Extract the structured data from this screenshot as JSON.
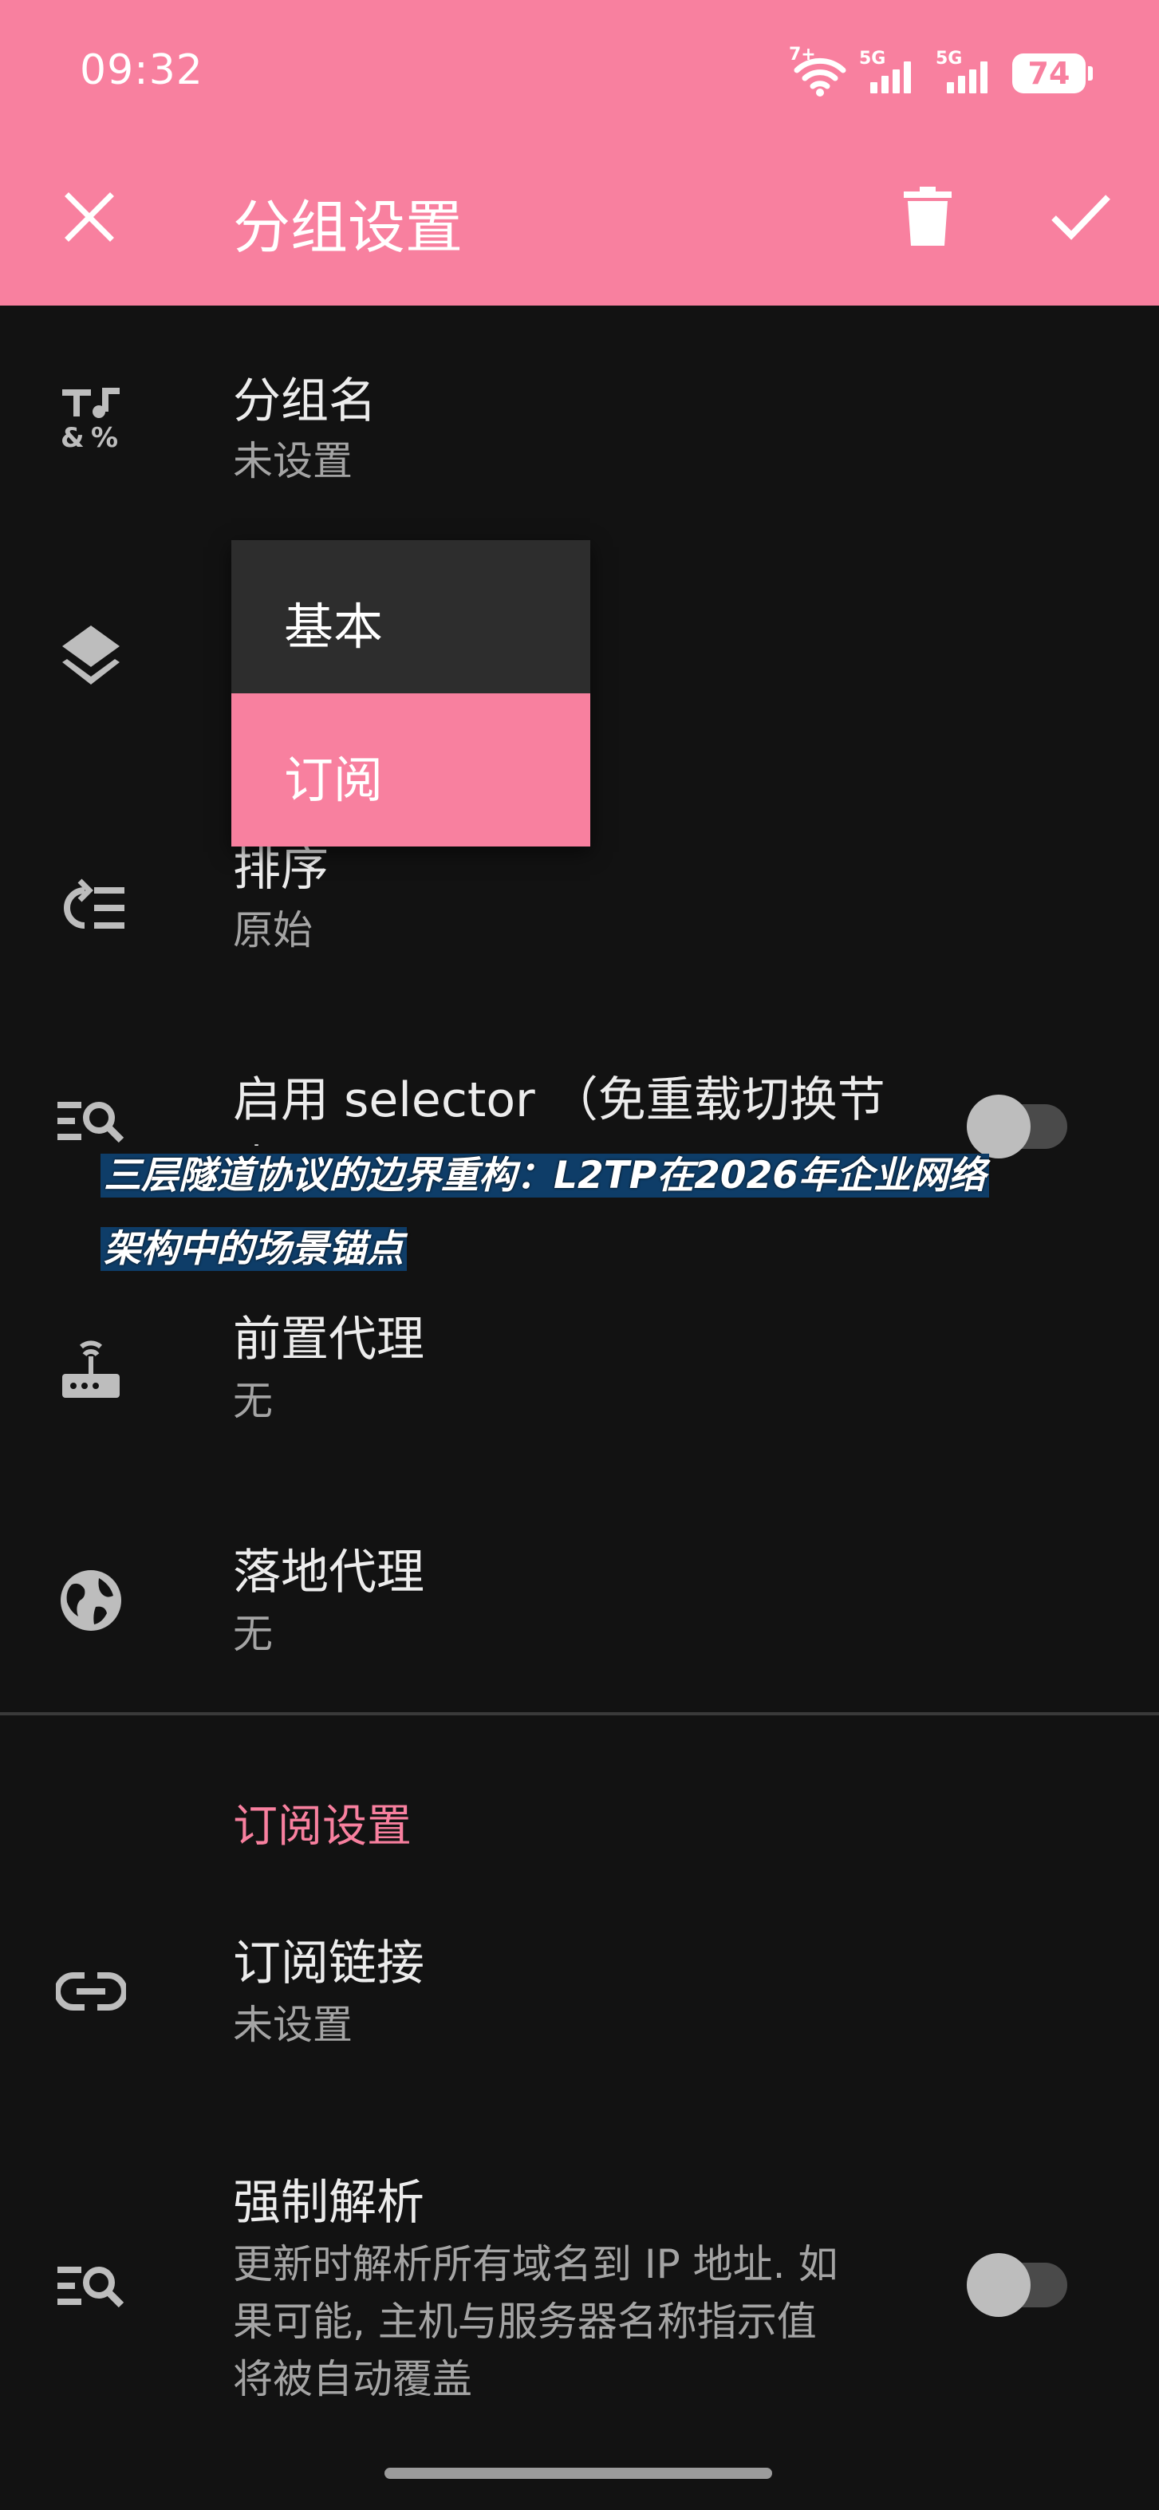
{
  "status_bar": {
    "time": "09:32",
    "wifi_label": "7+",
    "sim1_label": "5G",
    "sim2_label": "5G",
    "battery": "74"
  },
  "appbar": {
    "title": "分组设置",
    "close_icon": "close-icon",
    "delete_icon": "trash-icon",
    "confirm_icon": "check-icon"
  },
  "settings": {
    "group_name": {
      "title": "分组名",
      "value": "未设置",
      "icon": "text-format-icon"
    },
    "group_type": {
      "icon": "layers-icon"
    },
    "order": {
      "title": "排序",
      "value": "原始",
      "icon": "sort-icon"
    },
    "selector": {
      "title": "启用 selector （免重载切换节点)",
      "icon": "manage-search-icon",
      "enabled": false
    },
    "front_proxy": {
      "title": "前置代理",
      "value": "无",
      "icon": "router-icon"
    },
    "landing_proxy": {
      "title": "落地代理",
      "value": "无",
      "icon": "globe-icon"
    }
  },
  "subscription_section": {
    "header": "订阅设置",
    "link": {
      "title": "订阅链接",
      "value": "未设置",
      "icon": "link-icon"
    },
    "force_resolve": {
      "title": "强制解析",
      "description_lines": [
        "更新时解析所有域名到 IP 地址. 如",
        "果可能, 主机与服务器名称指示值",
        "将被自动覆盖"
      ],
      "icon": "manage-search-icon",
      "enabled": false
    }
  },
  "type_menu": {
    "options": [
      "基本",
      "订阅"
    ],
    "selected": "订阅"
  },
  "overlay_banner": {
    "line1": "三层隧道协议的边界重构：L2TP在2026年企业网络",
    "line2": "架构中的场景锚点"
  },
  "colors": {
    "accent": "#f8809f",
    "background": "#121212",
    "menu_bg": "#2d2d2d"
  }
}
